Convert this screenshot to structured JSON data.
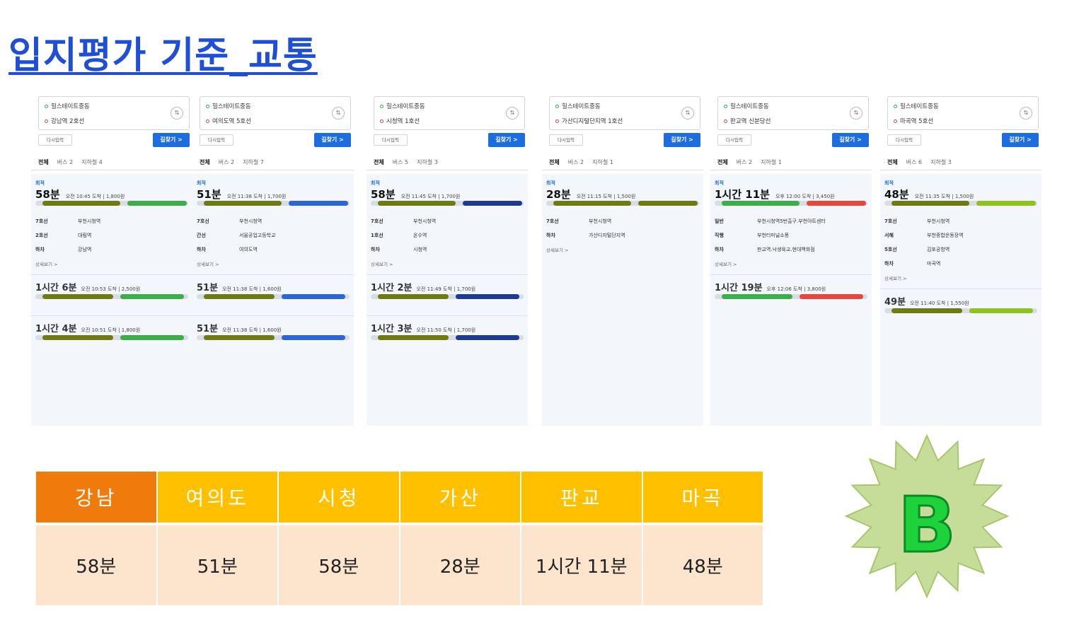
{
  "page_title": "입지평가 기준_교통",
  "panels": [
    {
      "from": "힐스테이트중동",
      "to": "강남역 2호선",
      "tabs": [
        "전체",
        "버스 2",
        "지하철 4"
      ],
      "best_label": "최적",
      "time": "58분",
      "detail": "오전 10:45 도착 | 1,800원",
      "steps": [
        [
          "7호선",
          "부천시청역"
        ],
        [
          "2호선",
          "대림역"
        ],
        [
          "하차",
          "강남역"
        ]
      ],
      "alts": [
        [
          "1시간 6분",
          "오전 10:53 도착 | 2,500원"
        ],
        [
          "1시간 4분",
          "오전 10:51 도착 | 1,800원"
        ]
      ],
      "colors": [
        "#6e7b12",
        "#3cae49"
      ]
    },
    {
      "from": "힐스테이트중동",
      "to": "여의도역 5호선",
      "tabs": [
        "전체",
        "버스 2",
        "지하철 7"
      ],
      "best_label": "최적",
      "time": "51분",
      "detail": "오전 11:38 도착 | 1,700원",
      "steps": [
        [
          "7호선",
          "부천시청역"
        ],
        [
          "간선",
          "서울공업고등학교"
        ],
        [
          "하차",
          "여의도역"
        ]
      ],
      "alts": [
        [
          "51분",
          "오전 11:38 도착 | 1,600원"
        ],
        [
          "51분",
          "오전 11:38 도착 | 1,600원"
        ]
      ],
      "colors": [
        "#6e7b12",
        "#2c66d6"
      ]
    },
    {
      "from": "힐스테이트중동",
      "to": "시청역 1호선",
      "tabs": [
        "전체",
        "버스 5",
        "지하철 3"
      ],
      "best_label": "최적",
      "time": "58분",
      "detail": "오전 11:45 도착 | 1,700원",
      "steps": [
        [
          "7호선",
          "부천시청역"
        ],
        [
          "1호선",
          "온수역"
        ],
        [
          "하차",
          "시청역"
        ]
      ],
      "alts": [
        [
          "1시간 2분",
          "오전 11:49 도착 | 1,700원"
        ],
        [
          "1시간 3분",
          "오전 11:50 도착 | 1,700원"
        ]
      ],
      "colors": [
        "#6e7b12",
        "#1f3a93"
      ]
    },
    {
      "from": "힐스테이트중동",
      "to": "가산디지털단지역 1호선",
      "tabs": [
        "전체",
        "버스 2",
        "지하철 1"
      ],
      "best_label": "최적",
      "time": "28분",
      "detail": "오전 11:15 도착 | 1,500원",
      "steps": [
        [
          "7호선",
          "부천시청역"
        ],
        [
          "하차",
          "가산디지털단지역"
        ]
      ],
      "alts": [],
      "colors": [
        "#6e7b12",
        "#6e7b12"
      ]
    },
    {
      "from": "힐스테이트중동",
      "to": "판교역 신분당선",
      "tabs": [
        "전체",
        "버스 2",
        "지하철 1"
      ],
      "best_label": "최적",
      "time": "1시간 11분",
      "detail": "오후 12:00 도착 | 3,450원",
      "steps": [
        [
          "일반",
          "부천시청역5번출구.부천아트센터"
        ],
        [
          "직행",
          "부천터미널소풍"
        ],
        [
          "하차",
          "판교역.낙생육교.현대백화점"
        ]
      ],
      "alts": [
        [
          "1시간 19분",
          "오후 12:06 도착 | 3,800원"
        ]
      ],
      "colors": [
        "#3cae49",
        "#e8463c"
      ]
    },
    {
      "from": "힐스테이트중동",
      "to": "마곡역 5호선",
      "tabs": [
        "전체",
        "버스 6",
        "지하철 3"
      ],
      "best_label": "최적",
      "time": "48분",
      "detail": "오전 11:35 도착 | 1,500원",
      "steps": [
        [
          "7호선",
          "부천시청역"
        ],
        [
          "서해",
          "부천종합운동장역"
        ],
        [
          "5호선",
          "김포공항역"
        ],
        [
          "하차",
          "마곡역"
        ]
      ],
      "alts": [
        [
          "49분",
          "오전 11:40 도착 | 1,550원"
        ]
      ],
      "colors": [
        "#6e7b12",
        "#8dc21f"
      ]
    }
  ],
  "ui": {
    "reenter": "다시입력",
    "find": "길찾기 >",
    "more": "상세보기 >"
  },
  "table": {
    "headers": [
      "강남",
      "여의도",
      "시청",
      "가산",
      "판교",
      "마곡"
    ],
    "values": [
      "58분",
      "51분",
      "58분",
      "28분",
      "1시간 11분",
      "48분"
    ]
  },
  "grade": "B",
  "colors": {
    "title": "#1f4fd6",
    "header_first": "#f07b0d",
    "header": "#ffc000",
    "cell": "#fde4cc",
    "badge_fill": "#c6dd9a",
    "badge_letter": "#1ed23c"
  }
}
